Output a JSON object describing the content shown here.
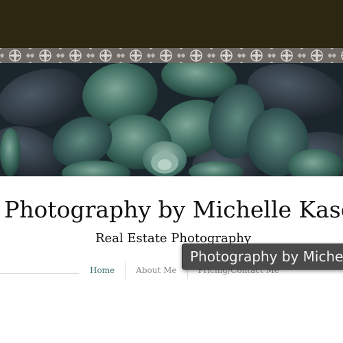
{
  "site": {
    "title": "Photography by Michelle Kaser",
    "tagline": "Real Estate Photography"
  },
  "nav": {
    "items": [
      {
        "label": "Home",
        "active": true
      },
      {
        "label": "About Me",
        "active": false
      },
      {
        "label": "Pricing/Contact Me",
        "active": false
      }
    ]
  },
  "tooltip": {
    "text": "Photography by Michelle Kaser"
  },
  "colors": {
    "top_bar": "#2b2710",
    "pattern_strip": "#6f6a66",
    "nav_active": "#3b6e6e",
    "tooltip_bg": "#4a4a4a"
  }
}
